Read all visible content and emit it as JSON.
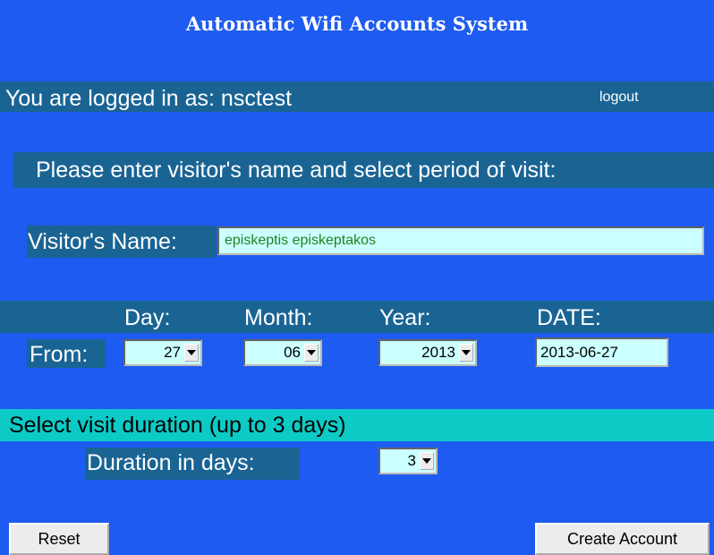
{
  "header": {
    "title": "Automatic Wifi Accounts System"
  },
  "session": {
    "logged_in_text": "You are logged in as: nsctest",
    "logout_label": "logout"
  },
  "form": {
    "prompt": "Please enter visitor's name and select period of visit:",
    "visitor_name_label": "Visitor's Name:",
    "visitor_name_value": "episkeptis episkeptakos",
    "columns": {
      "day": "Day:",
      "month": "Month:",
      "year": "Year:",
      "date": "DATE:"
    },
    "from_label": "From:",
    "day_value": "27",
    "month_value": "06",
    "year_value": "2013",
    "date_value": "2013-06-27",
    "duration_heading": "Select visit duration (up to 3 days)",
    "duration_label": "Duration in days:",
    "duration_value": "3",
    "reset_label": "Reset",
    "create_label": "Create Account"
  },
  "colors": {
    "background": "#1e5bf0",
    "band": "#1a6494",
    "duration_band": "#0ccbc7",
    "input_bg": "#ccffff",
    "name_text": "#218321"
  },
  "icons": {
    "dropdown": "chevron-down-icon"
  }
}
